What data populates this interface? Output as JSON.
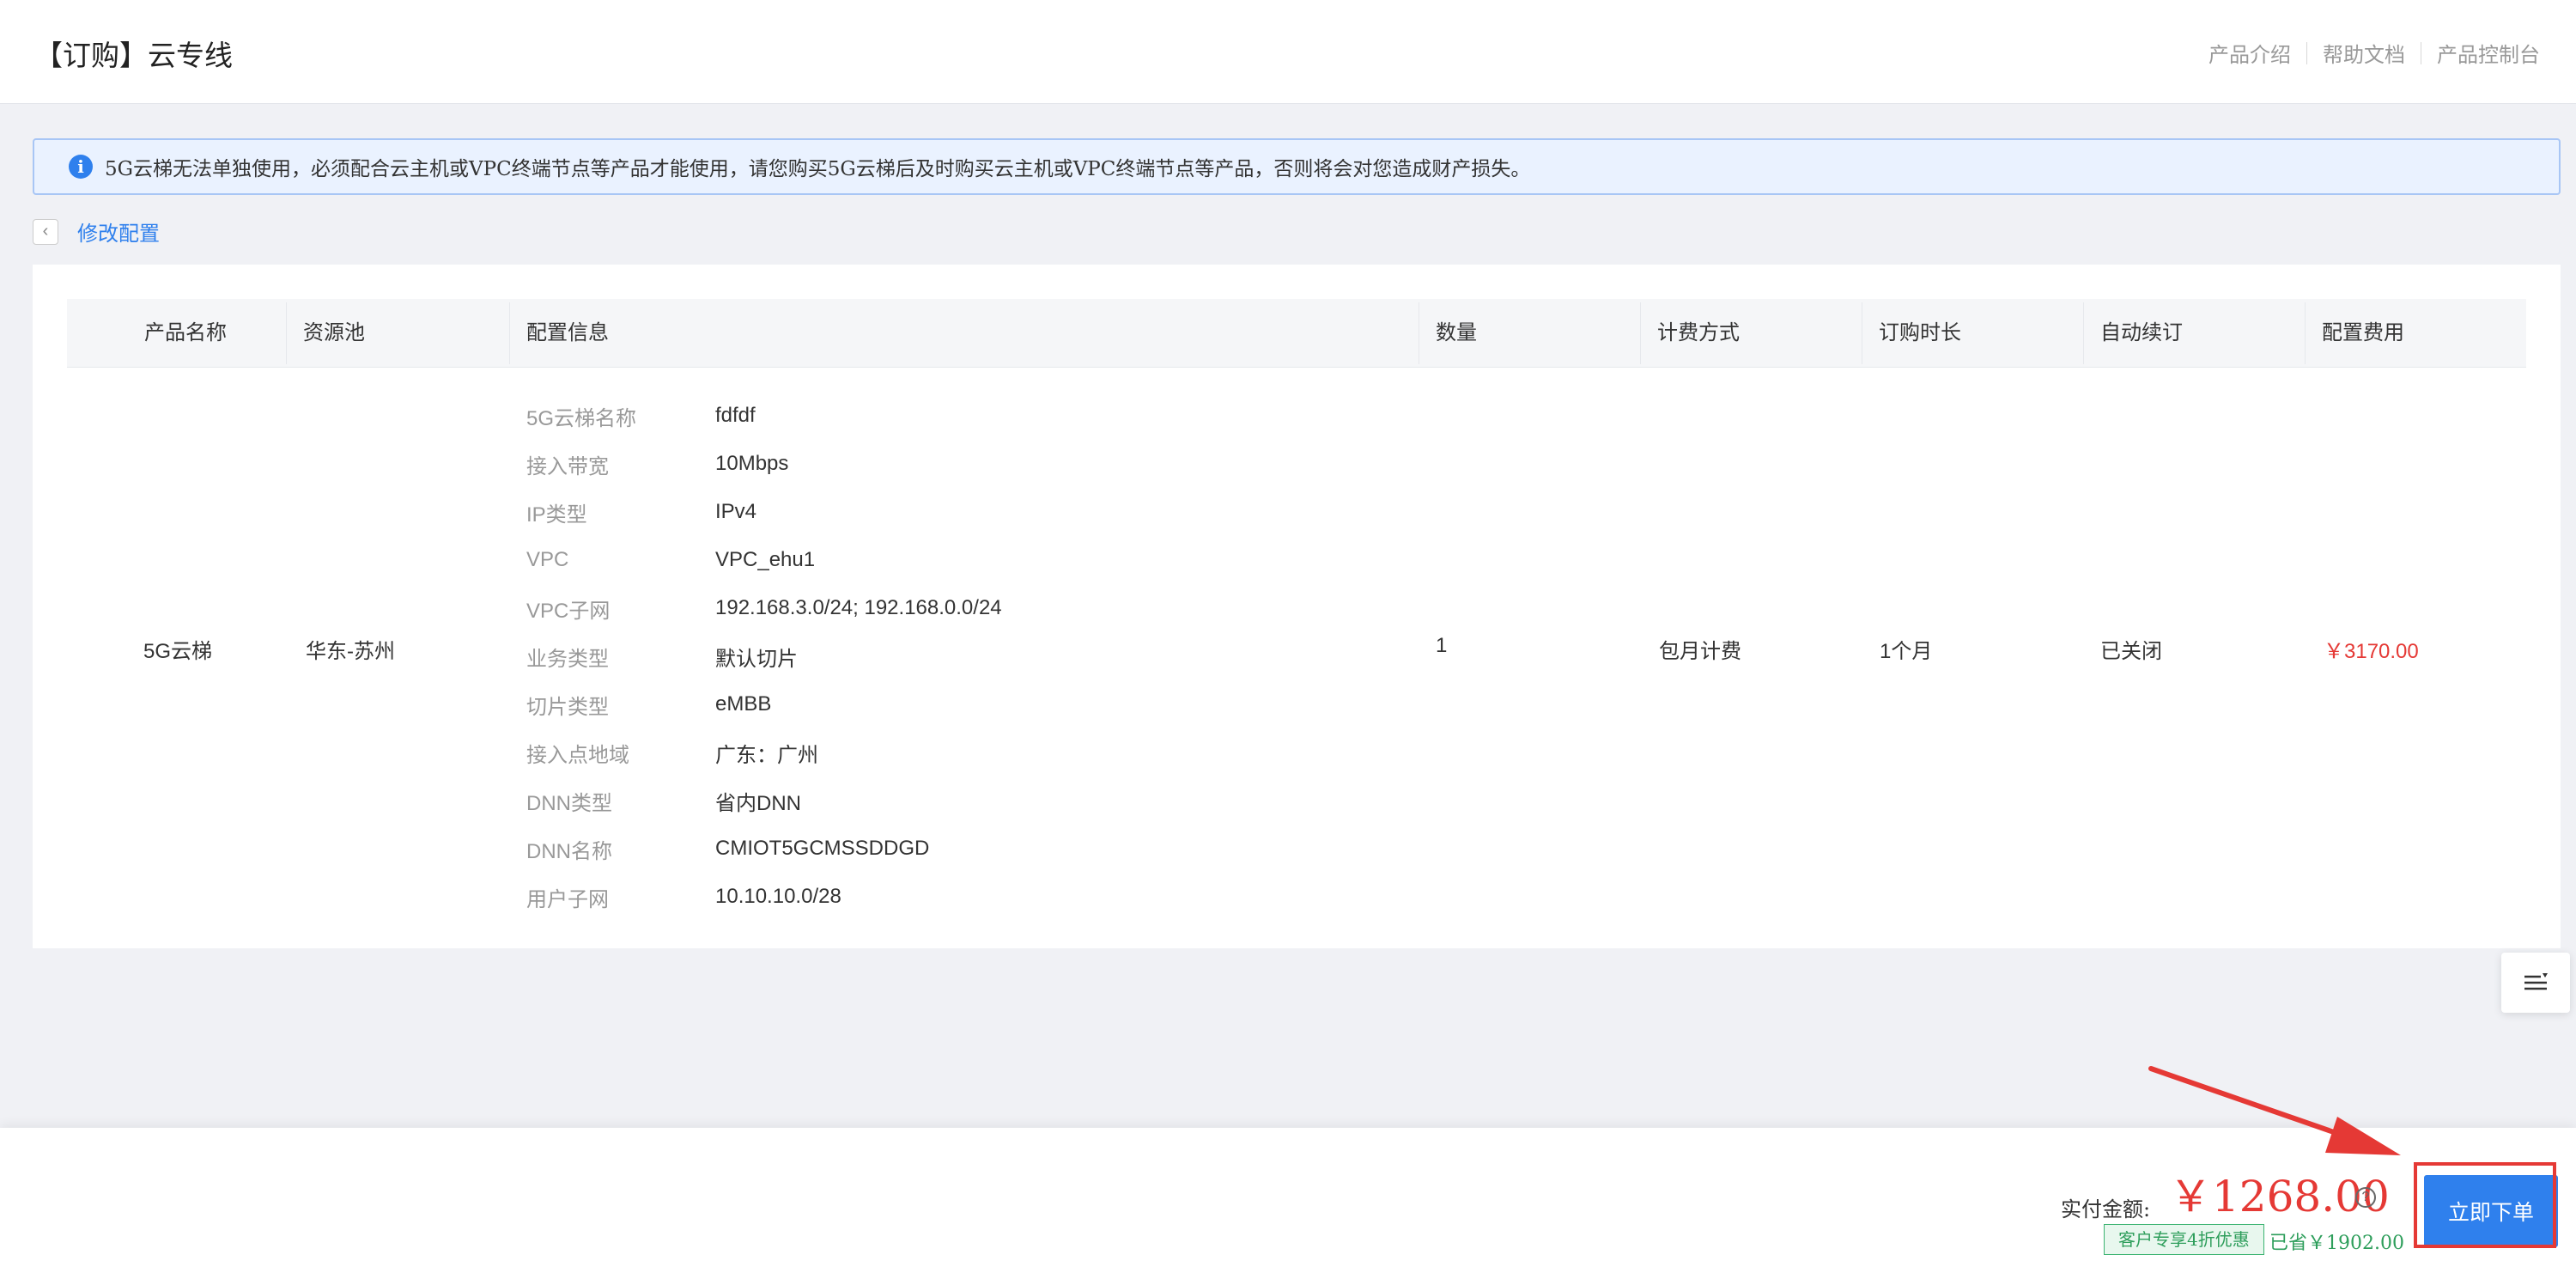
{
  "header": {
    "title": "【订购】云专线",
    "links": [
      "产品介绍",
      "帮助文档",
      "产品控制台"
    ]
  },
  "notice": {
    "icon": "info-icon",
    "text": "5G云梯无法单独使用，必须配合云主机或VPC终端节点等产品才能使用，请您购买5G云梯后及时购买云主机或VPC终端节点等产品，否则将会对您造成财产损失。"
  },
  "back": {
    "label": "修改配置"
  },
  "table": {
    "columns": [
      "产品名称",
      "资源池",
      "配置信息",
      "数量",
      "计费方式",
      "订购时长",
      "自动续订",
      "配置费用"
    ],
    "row": {
      "product": "5G云梯",
      "pool": "华东-苏州",
      "quantity": "1",
      "billing": "包月计费",
      "duration": "1个月",
      "auto_renew": "已关闭",
      "price": "￥3170.00",
      "config": [
        {
          "label": "5G云梯名称",
          "value": "fdfdf"
        },
        {
          "label": "接入带宽",
          "value": "10Mbps"
        },
        {
          "label": "IP类型",
          "value": "IPv4"
        },
        {
          "label": "VPC",
          "value": "VPC_ehu1"
        },
        {
          "label": "VPC子网",
          "value": "192.168.3.0/24; 192.168.0.0/24"
        },
        {
          "label": "业务类型",
          "value": "默认切片"
        },
        {
          "label": "切片类型",
          "value": "eMBB"
        },
        {
          "label": "接入点地域",
          "value": "广东：广州"
        },
        {
          "label": "DNN类型",
          "value": "省内DNN"
        },
        {
          "label": "DNN名称",
          "value": "CMIOT5GCMSSDDGD"
        },
        {
          "label": "用户子网",
          "value": "10.10.10.0/28"
        }
      ]
    }
  },
  "footer": {
    "pay_label": "实付金额:",
    "pay_amount": "￥1268.00",
    "discount_badge": "客户专享4折优惠",
    "saved": "已省￥1902.00",
    "order_button": "立即下单"
  },
  "colors": {
    "accent": "#2f80ed",
    "price": "#e53935",
    "discount": "#2e9e5b",
    "annotation": "#e53935"
  }
}
